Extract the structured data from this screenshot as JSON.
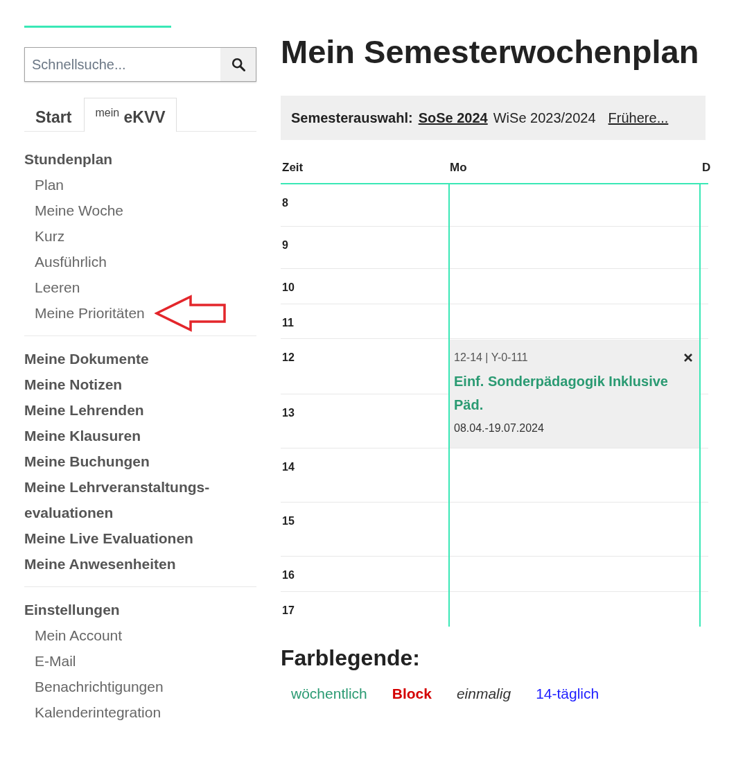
{
  "sidebar": {
    "search": {
      "placeholder": "Schnellsuche..."
    },
    "tabs": [
      {
        "label": "Start",
        "selected": false
      },
      {
        "label": "$^{mein}$ eKVV",
        "selected": true
      }
    ],
    "sections": [
      {
        "kind": "group",
        "heading": "Stundenplan",
        "items": [
          {
            "label": "Plan",
            "marked": false
          },
          {
            "label": "Meine Woche",
            "marked": false
          },
          {
            "label": "Kurz",
            "marked": false
          },
          {
            "label": "Ausführlich",
            "marked": false
          },
          {
            "label": "Leeren",
            "marked": false
          },
          {
            "label": "Meine Prioritäten",
            "marked": true
          }
        ]
      },
      {
        "kind": "links",
        "items": [
          {
            "label": "Meine Dokumente"
          },
          {
            "label": "Meine Notizen"
          },
          {
            "label": "Meine Lehrenden"
          },
          {
            "label": "Meine Klausuren"
          },
          {
            "label": "Meine Buchungen"
          },
          {
            "label": "Meine Lehrveranstaltungs-evaluationen"
          },
          {
            "label": "Meine Live Evaluationen"
          },
          {
            "label": "Meine Anwesenheiten"
          }
        ]
      },
      {
        "kind": "group",
        "heading": "Einstellungen",
        "items": [
          {
            "label": "Mein Account"
          },
          {
            "label": "E-Mail"
          },
          {
            "label": "Benachrichtigungen"
          },
          {
            "label": "Kalenderintegration"
          }
        ]
      }
    ]
  },
  "main": {
    "title": "Mein Semesterwochenplan",
    "semester_bar": {
      "label": "Semesterauswahl:",
      "semesters": [
        {
          "label": "SoSe 2024",
          "selected": true
        },
        {
          "label": "WiSe 2023/2024",
          "selected": false
        }
      ],
      "earlier_link": "Frühere..."
    },
    "timetable": {
      "columns": [
        "Zeit",
        "Mo",
        "D"
      ],
      "rows": [
        {
          "hour": "8"
        },
        {
          "hour": "9"
        },
        {
          "hour": "10"
        },
        {
          "hour": "11"
        },
        {
          "hour": "12",
          "event": {
            "kind": "weekly",
            "time": "12-14 | Y-0-111",
            "title": "Einf. Sonderpädagogik Inklusive Päd.",
            "dates": "08.04.-19.07.2024"
          }
        },
        {
          "hour": "13"
        },
        {
          "hour": "14"
        },
        {
          "hour": "15"
        },
        {
          "hour": "16"
        },
        {
          "hour": "17"
        }
      ]
    },
    "legend": {
      "title": "Farblegende:",
      "items": [
        {
          "kind": "weekly",
          "label": "wöchentlich",
          "color": "#2a9a72"
        },
        {
          "kind": "block",
          "label": "Block",
          "color": "#d40000"
        },
        {
          "kind": "single",
          "label": "einmalig",
          "color": "#333333"
        },
        {
          "kind": "biweekly",
          "label": "14-täglich",
          "color": "#2020ff"
        }
      ]
    }
  }
}
